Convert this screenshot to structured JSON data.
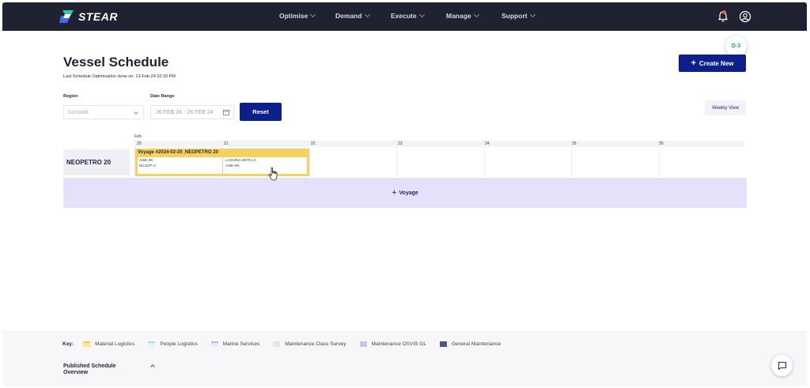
{
  "brand": {
    "name": "STEAR"
  },
  "nav": {
    "items": [
      {
        "label": "Optimise"
      },
      {
        "label": "Demand"
      },
      {
        "label": "Execute"
      },
      {
        "label": "Manage"
      },
      {
        "label": "Support"
      }
    ],
    "notification_color": "#f0612a"
  },
  "badge": {
    "label": "D-3"
  },
  "page": {
    "title": "Vessel Schedule",
    "subtitle": "Last Schedule Optimisation done on: 13-Feb-24 02:33 PM",
    "create_label": "Create New"
  },
  "filters": {
    "region_label": "Region",
    "region_value": "Sarawak",
    "date_label": "Date Range",
    "date_value": "20 FEB 24 - 26 FEB 24",
    "reset_label": "Reset",
    "view_label": "Weekly View"
  },
  "schedule": {
    "month": "Feb",
    "days": [
      "20",
      "21",
      "22",
      "23",
      "24",
      "25",
      "26"
    ],
    "vessel": "NEOPETRO 20",
    "voyage": {
      "title": "Voyage #2024-02-20_NEOPETRO 20",
      "stops": [
        {
          "line1": "ASB-SK",
          "line2": "NC3CP-A"
        },
        {
          "line1": "LAGUNA SETIA 2",
          "line2": "ASB-SK"
        }
      ]
    },
    "add_voyage_label": "Voyage"
  },
  "legend": {
    "title": "Key:",
    "items": [
      {
        "label": "Material Logistics",
        "color": "#fde68a",
        "border": "#f5c842"
      },
      {
        "label": "People Logistics",
        "color": "#e0f2f4",
        "border": "#b9dde2"
      },
      {
        "label": "Marine Services",
        "color": "#e3ecfb",
        "border": "#a9c1ea"
      },
      {
        "label": "Maintenance Class Survey",
        "color": "#e7e8ec",
        "border": "#e7e8ec"
      },
      {
        "label": "Maintenance OSVIS GL",
        "color": "#c9c6e8",
        "border": "#c9c6e8"
      },
      {
        "label": "General Maintenance",
        "color": "#4a5598",
        "border": "#4a5598"
      }
    ]
  },
  "published": {
    "title": "Published Schedule Overview"
  },
  "colors": {
    "primary": "#0c1f8c",
    "nav_bg": "#1f2231",
    "voyage": "#f7d15f",
    "add_row": "#e6e1fb"
  }
}
